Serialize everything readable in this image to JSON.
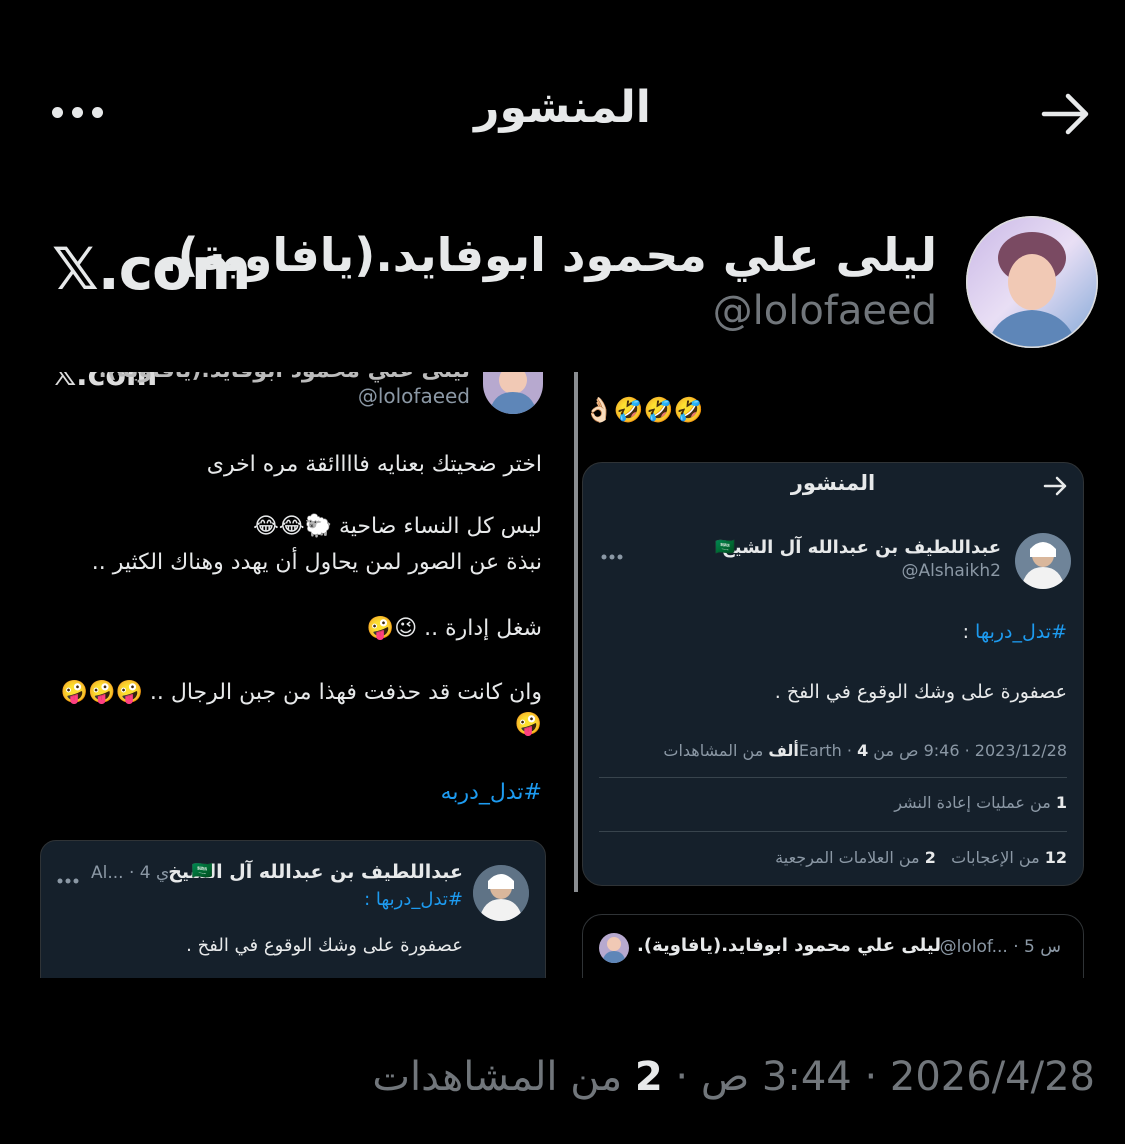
{
  "header": {
    "title": "المنشور",
    "more_icon": "more-dots-icon",
    "back_icon": "arrow-right-icon"
  },
  "post": {
    "author_name": "ليلى علي محمود ابوفايد.(يافاوية).",
    "author_handle": "@lolofaeed",
    "watermark": "𝕏.com",
    "timestamp": "2026/4/28 · 3:44 ص · ",
    "views_count": "2",
    "views_label": " من المشاهدات"
  },
  "left_image": {
    "top_watermark": "𝕏.com",
    "top_name": "ليلى علي محمود ابوفايد.(يافاوية).",
    "handle": "@lolofaeed",
    "lines": [
      "اختر ضحيتك بعنايه فاااائقة مره اخرى",
      "ليس كل النساء ضاحية 🐑😂😂",
      "نبذة عن الصور لمن يحاول أن يهدد وهناك الكثير ..",
      "شغل إدارة .. 😉🤪",
      "وان كانت قد حذفت فهذا من جبن الرجال .. 🤪🤪🤪",
      "🤪"
    ],
    "hashtag": "#تدل_دربه",
    "quote": {
      "name": "عبداللطيف بن عبدالله آل الشيخ",
      "flag": "🇸🇦",
      "meta": "Al... · 4 ي",
      "hashtag": "#تدل_دربها :",
      "text": "عصفورة على وشك الوقوع في الفخ ."
    }
  },
  "right_image": {
    "emoji_line": "👌🏻🤣🤣🤣",
    "card": {
      "title": "المنشور",
      "name": "عبداللطيف بن عبدالله آل الشيخ",
      "flag": "🇸🇦",
      "handle": "@Alshaikh2",
      "hashtag": "#تدل_دربها",
      "hashtag_suffix": " :",
      "text": "عصفورة على وشك الوقوع في الفخ .",
      "meta_date": "2023/12/28 · 9:46 ص من Earth · ",
      "meta_views_count": "4ألف",
      "meta_views_label": " من المشاهدات",
      "reposts_count": "1",
      "reposts_label": " من عمليات إعادة النشر",
      "likes_count": "12",
      "likes_label": " من الإعجابات",
      "bookmarks_count": "2",
      "bookmarks_label": " من العلامات المرجعية"
    },
    "reply": {
      "name": "ليلى علي محمود ابوفايد.(يافاوية).",
      "meta": "@lolof... · 5 س"
    }
  }
}
